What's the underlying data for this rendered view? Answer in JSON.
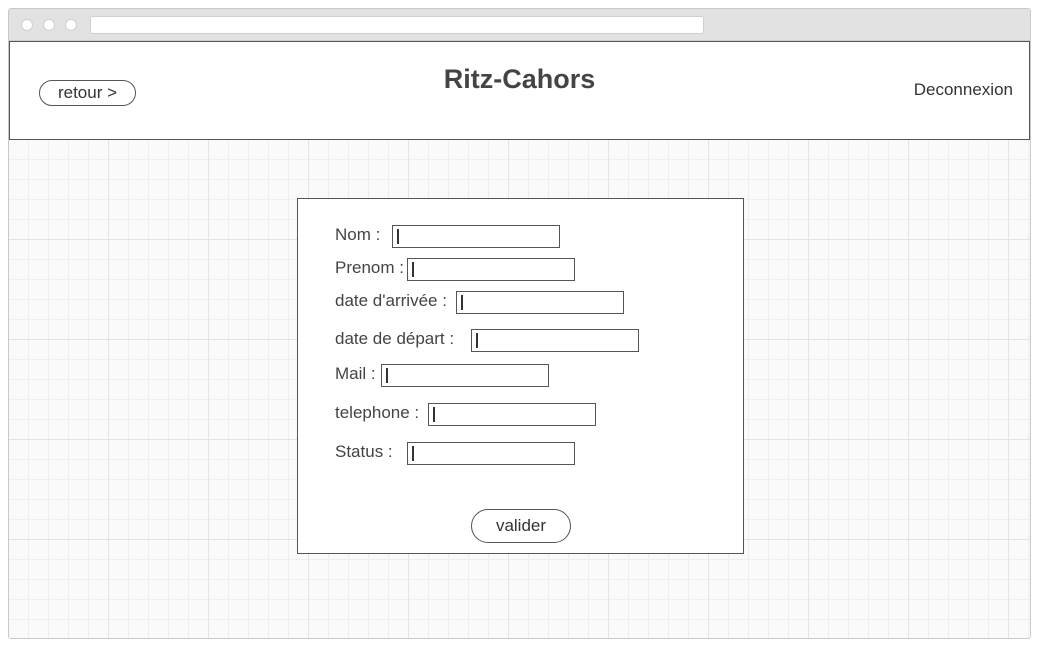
{
  "header": {
    "back_label": "retour >",
    "title": "Ritz-Cahors",
    "logout_label": "Deconnexion"
  },
  "form": {
    "fields": [
      {
        "label": "Nom :",
        "value": ""
      },
      {
        "label": "Prenom :",
        "value": ""
      },
      {
        "label": "date d'arrivée :",
        "value": ""
      },
      {
        "label": "date de départ :",
        "value": ""
      },
      {
        "label": "Mail :",
        "value": ""
      },
      {
        "label": "telephone :",
        "value": ""
      },
      {
        "label": "Status :",
        "value": ""
      }
    ],
    "submit_label": "valider"
  }
}
